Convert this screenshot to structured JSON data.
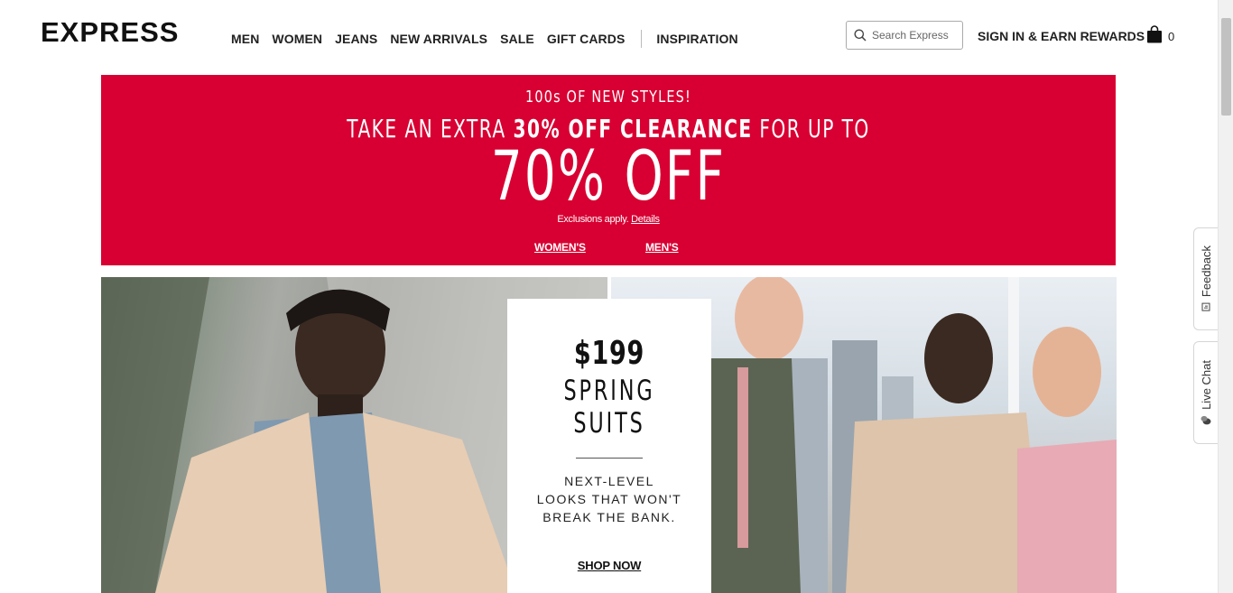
{
  "header": {
    "logo": "EXPRESS",
    "nav": [
      {
        "label": "MEN"
      },
      {
        "label": "WOMEN"
      },
      {
        "label": "JEANS"
      },
      {
        "label": "NEW ARRIVALS"
      },
      {
        "label": "SALE"
      },
      {
        "label": "GIFT CARDS"
      }
    ],
    "nav_extra": "INSPIRATION",
    "search_placeholder": "Search Express",
    "signin": "SIGN IN & EARN REWARDS",
    "bag_count": "0"
  },
  "promo": {
    "line1": "100s OF NEW STYLES!",
    "line2_pre": "TAKE AN EXTRA ",
    "line2_bold": "30% OFF CLEARANCE",
    "line2_post": " FOR UP TO",
    "big": "70% OFF",
    "exclusions": "Exclusions apply.",
    "details_link": "Details",
    "womens_link": "WOMEN'S",
    "mens_link": "MEN'S",
    "background_color": "#d80032"
  },
  "hero": {
    "price": "$199",
    "title_line1": "SPRING",
    "title_line2": "SUITS",
    "sub_line1": "NEXT-LEVEL",
    "sub_line2": "LOOKS THAT WON'T",
    "sub_line3": "BREAK THE BANK.",
    "cta": "SHOP NOW"
  },
  "side_tabs": {
    "feedback": "Feedback",
    "live_chat": "Live Chat"
  }
}
